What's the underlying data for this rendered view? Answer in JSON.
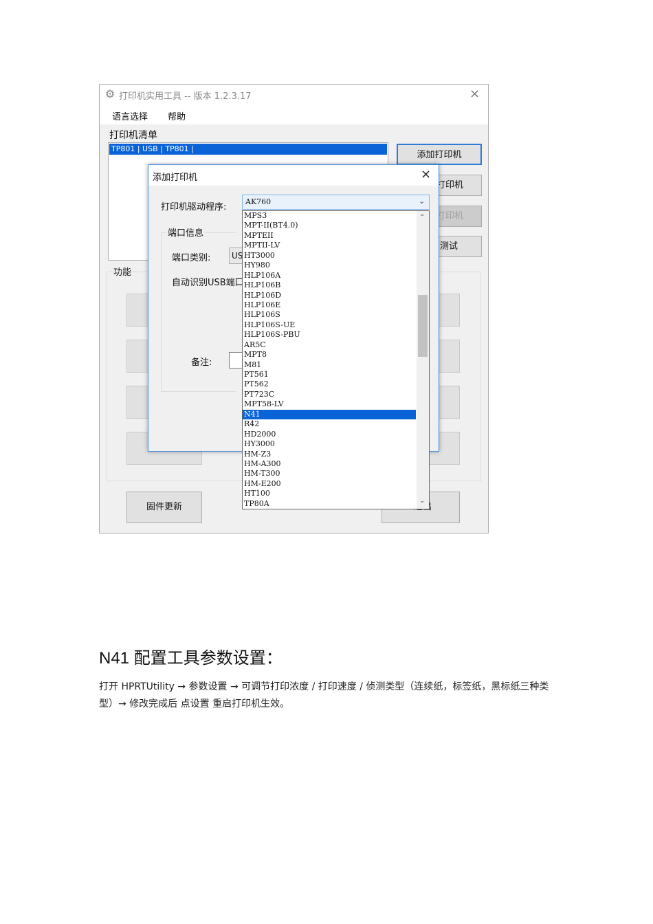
{
  "main_window": {
    "title": "打印机实用工具 -- 版本 1.2.3.17",
    "close_glyph": "×",
    "app_icon": "gear-icon",
    "menu": [
      "语言选择",
      "帮助"
    ],
    "printer_list_label": "打印机清单",
    "printer_list": [
      "TP801 | USB | TP801 |"
    ],
    "side_buttons": [
      "添加打印机",
      "打印机",
      "打印机",
      "测试"
    ],
    "function_label": "功能",
    "firmware_button": "固件更新",
    "exit_button": "退出"
  },
  "dialog": {
    "title": "添加打印机",
    "close_glyph": "×",
    "driver_label": "打印机驱动程序:",
    "driver_value": "AK760",
    "port_group_label": "端口信息",
    "port_type_label": "端口类别:",
    "port_type_value": "US",
    "auto_usb_label": "自动识别USB端口",
    "remark_label": "备注:"
  },
  "dropdown": {
    "items": [
      "MPS3",
      "MPT-II(BT4.0)",
      "MPTEII",
      "MPTII-LV",
      "HT3000",
      "HY980",
      "HLP106A",
      "HLP106B",
      "HLP106D",
      "HLP106E",
      "HLP106S",
      "HLP106S-UE",
      "HLP106S-PBU",
      "AR5C",
      "MPT8",
      "M81",
      "PT561",
      "PT562",
      "PT723C",
      "MPT58-LV",
      "N41",
      "R42",
      "HD2000",
      "HY3000",
      "HM-Z3",
      "HM-A300",
      "HM-T300",
      "HM-E200",
      "HT100",
      "TP80A"
    ],
    "selected": "N41",
    "scroll_up_glyph": "⌃",
    "scroll_down_glyph": "⌄"
  },
  "document": {
    "heading": "N41 配置工具参数设置：",
    "paragraph": "打开 HPRTUtility → 参数设置 → 可调节打印浓度 / 打印速度 / 侦测类型（连续纸，标签纸，黑标纸三种类型）→ 修改完成后 点设置 重启打印机生效。"
  },
  "colors": {
    "selection": "#0a64d8",
    "window_bg": "#f0f0f0",
    "accent_border": "#2f7bd8"
  }
}
